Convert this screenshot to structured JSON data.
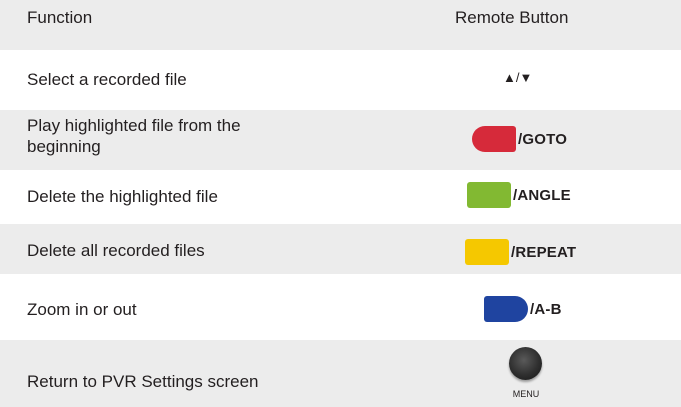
{
  "header": {
    "function_label": "Function",
    "button_label": "Remote Button"
  },
  "rows": [
    {
      "function": "Select a recorded file",
      "button": "▲/▼"
    },
    {
      "function_line1": "Play highlighted file from the",
      "function_line2": "beginning",
      "button": "/GOTO",
      "key_color": "#d62a3a"
    },
    {
      "function": "Delete the highlighted file",
      "button": "/ANGLE",
      "key_color": "#82b932"
    },
    {
      "function": "Delete all recorded files",
      "button": "/REPEAT",
      "key_color": "#f5c800"
    },
    {
      "function": "Zoom in or out",
      "button": "/A-B",
      "key_color": "#1f44a0"
    },
    {
      "function": "Return to PVR Settings screen",
      "button": "MENU"
    }
  ],
  "colors": {
    "row_shade": "#ececec",
    "text": "#231f20"
  }
}
